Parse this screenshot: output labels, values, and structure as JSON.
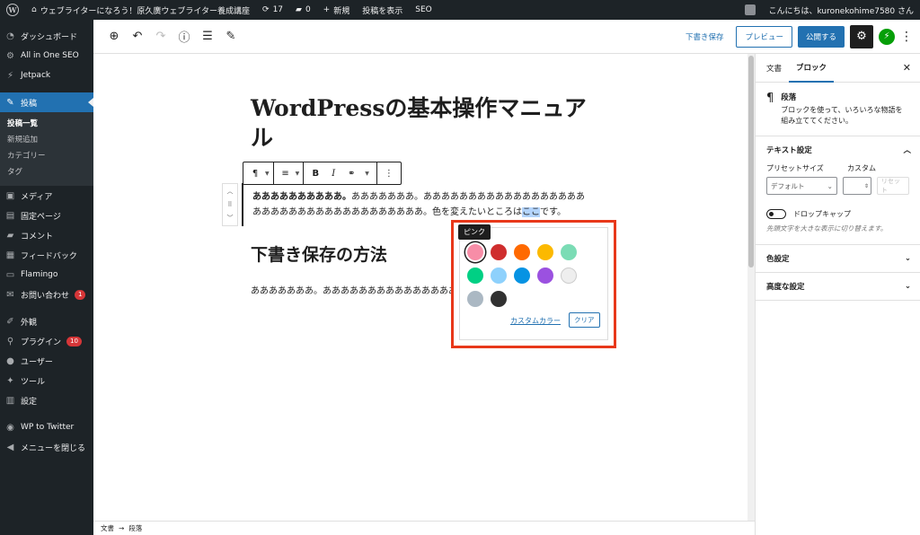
{
  "admin_bar": {
    "site_name": "ウェブライターになろう！原久廣ウェブライター養成講座",
    "updates": "17",
    "comments": "0",
    "new_label": "新規",
    "view_post": "投稿を表示",
    "seo": "SEO",
    "greeting": "こんにちは、kuronekohime7580 さん"
  },
  "sidebar": {
    "items": [
      {
        "label": "ダッシュボード",
        "icon": "dashboard-icon"
      },
      {
        "label": "All in One SEO",
        "icon": "gear-icon"
      },
      {
        "label": "Jetpack",
        "icon": "jetpack-icon"
      },
      {
        "label": "投稿",
        "icon": "pin-icon"
      },
      {
        "label": "メディア",
        "icon": "media-icon"
      },
      {
        "label": "固定ページ",
        "icon": "page-icon"
      },
      {
        "label": "コメント",
        "icon": "comment-icon"
      },
      {
        "label": "フィードバック",
        "icon": "feedback-icon"
      },
      {
        "label": "Flamingo",
        "icon": "flamingo-icon"
      },
      {
        "label": "お問い合わせ",
        "icon": "mail-icon",
        "badge": "1"
      },
      {
        "label": "外観",
        "icon": "brush-icon"
      },
      {
        "label": "プラグイン",
        "icon": "plugin-icon",
        "badge": "10"
      },
      {
        "label": "ユーザー",
        "icon": "user-icon"
      },
      {
        "label": "ツール",
        "icon": "wrench-icon"
      },
      {
        "label": "設定",
        "icon": "settings-icon"
      },
      {
        "label": "WP to Twitter",
        "icon": "twitter-icon"
      },
      {
        "label": "メニューを閉じる",
        "icon": "collapse-icon"
      }
    ],
    "submenu": [
      "投稿一覧",
      "新規追加",
      "カテゴリー",
      "タグ"
    ]
  },
  "header": {
    "save_draft": "下書き保存",
    "preview": "プレビュー",
    "publish": "公開する"
  },
  "editor": {
    "title": "WordPressの基本操作マニュアル",
    "para_bold": "ああああああああああ。",
    "para_text1": "あああああああ。あああああああああああああああああああああああああああああああああああああ。色を変えたいところは",
    "para_selected": "ここ",
    "para_text2": "です。",
    "heading2": "下書き保存の方法",
    "para2": "あああああああ。あああああああああああああああ"
  },
  "color_popover": {
    "tooltip": "ピンク",
    "swatches": [
      "#f78da7",
      "#cf2e2e",
      "#ff6900",
      "#fcb900",
      "#7bdcb5",
      "#00d084",
      "#8ed1fc",
      "#0693e3",
      "#9b51e0",
      "#eeeeee",
      "#abb8c3",
      "#313131"
    ],
    "selected_index": 0,
    "custom_color": "カスタムカラー",
    "clear": "クリア"
  },
  "settings": {
    "tabs": [
      "文書",
      "ブロック"
    ],
    "block_name": "段落",
    "block_desc": "ブロックを使って、いろいろな物語を組み立ててください。",
    "text_settings": "テキスト設定",
    "preset_size_label": "プリセットサイズ",
    "custom_label": "カスタム",
    "preset_value": "デフォルト",
    "reset": "リセット",
    "drop_cap": "ドロップキャップ",
    "drop_cap_help": "先頭文字を大きな表示に切り替えます。",
    "color_settings": "色設定",
    "advanced": "高度な設定"
  },
  "footer": {
    "crumb1": "文書",
    "crumb2": "段落"
  },
  "colors": {
    "accent": "#2271b1",
    "admin_bg": "#1d2327",
    "highlight_box": "#e8381a"
  }
}
